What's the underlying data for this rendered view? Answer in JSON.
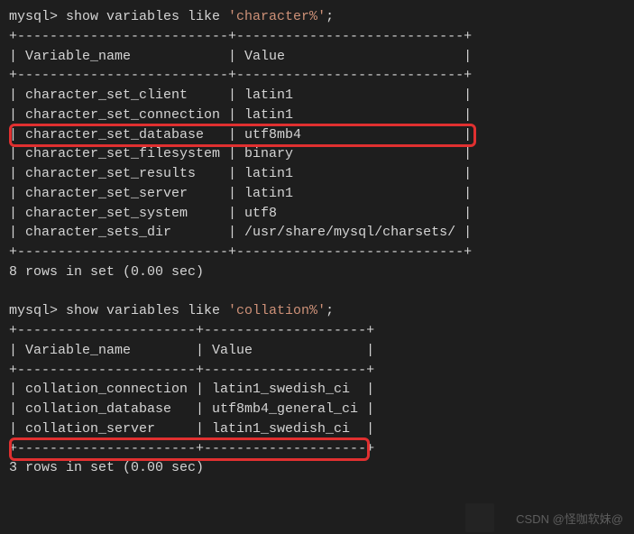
{
  "q1": {
    "prompt": "mysql>",
    "cmd_prefix": " show variables like ",
    "cmd_string": "'character%'",
    "cmd_suffix": ";",
    "border_top": "+--------------------------+----------------------------+",
    "header": "| Variable_name            | Value                      |",
    "rows": [
      "| character_set_client     | latin1                     |",
      "| character_set_connection | latin1                     |",
      "| character_set_database   | utf8mb4                    |",
      "| character_set_filesystem | binary                     |",
      "| character_set_results    | latin1                     |",
      "| character_set_server     | latin1                     |",
      "| character_set_system     | utf8                       |",
      "| character_sets_dir       | /usr/share/mysql/charsets/ |"
    ],
    "footer": "8 rows in set (0.00 sec)"
  },
  "q2": {
    "prompt": "mysql>",
    "cmd_prefix": " show variables like ",
    "cmd_string": "'collation%'",
    "cmd_suffix": ";",
    "border_top": "+----------------------+--------------------+",
    "header": "| Variable_name        | Value              |",
    "rows": [
      "| collation_connection | latin1_swedish_ci  |",
      "| collation_database   | utf8mb4_general_ci |",
      "| collation_server     | latin1_swedish_ci  |"
    ],
    "footer": "3 rows in set (0.00 sec)"
  },
  "watermark": "CSDN @怪咖软妹@",
  "chart_data": [
    {
      "type": "table",
      "title": "show variables like 'character%'",
      "columns": [
        "Variable_name",
        "Value"
      ],
      "rows": [
        [
          "character_set_client",
          "latin1"
        ],
        [
          "character_set_connection",
          "latin1"
        ],
        [
          "character_set_database",
          "utf8mb4"
        ],
        [
          "character_set_filesystem",
          "binary"
        ],
        [
          "character_set_results",
          "latin1"
        ],
        [
          "character_set_server",
          "latin1"
        ],
        [
          "character_set_system",
          "utf8"
        ],
        [
          "character_sets_dir",
          "/usr/share/mysql/charsets/"
        ]
      ],
      "highlighted_row_index": 2,
      "footer": "8 rows in set (0.00 sec)"
    },
    {
      "type": "table",
      "title": "show variables like 'collation%'",
      "columns": [
        "Variable_name",
        "Value"
      ],
      "rows": [
        [
          "collation_connection",
          "latin1_swedish_ci"
        ],
        [
          "collation_database",
          "utf8mb4_general_ci"
        ],
        [
          "collation_server",
          "latin1_swedish_ci"
        ]
      ],
      "highlighted_row_index": 1,
      "footer": "3 rows in set (0.00 sec)"
    }
  ]
}
